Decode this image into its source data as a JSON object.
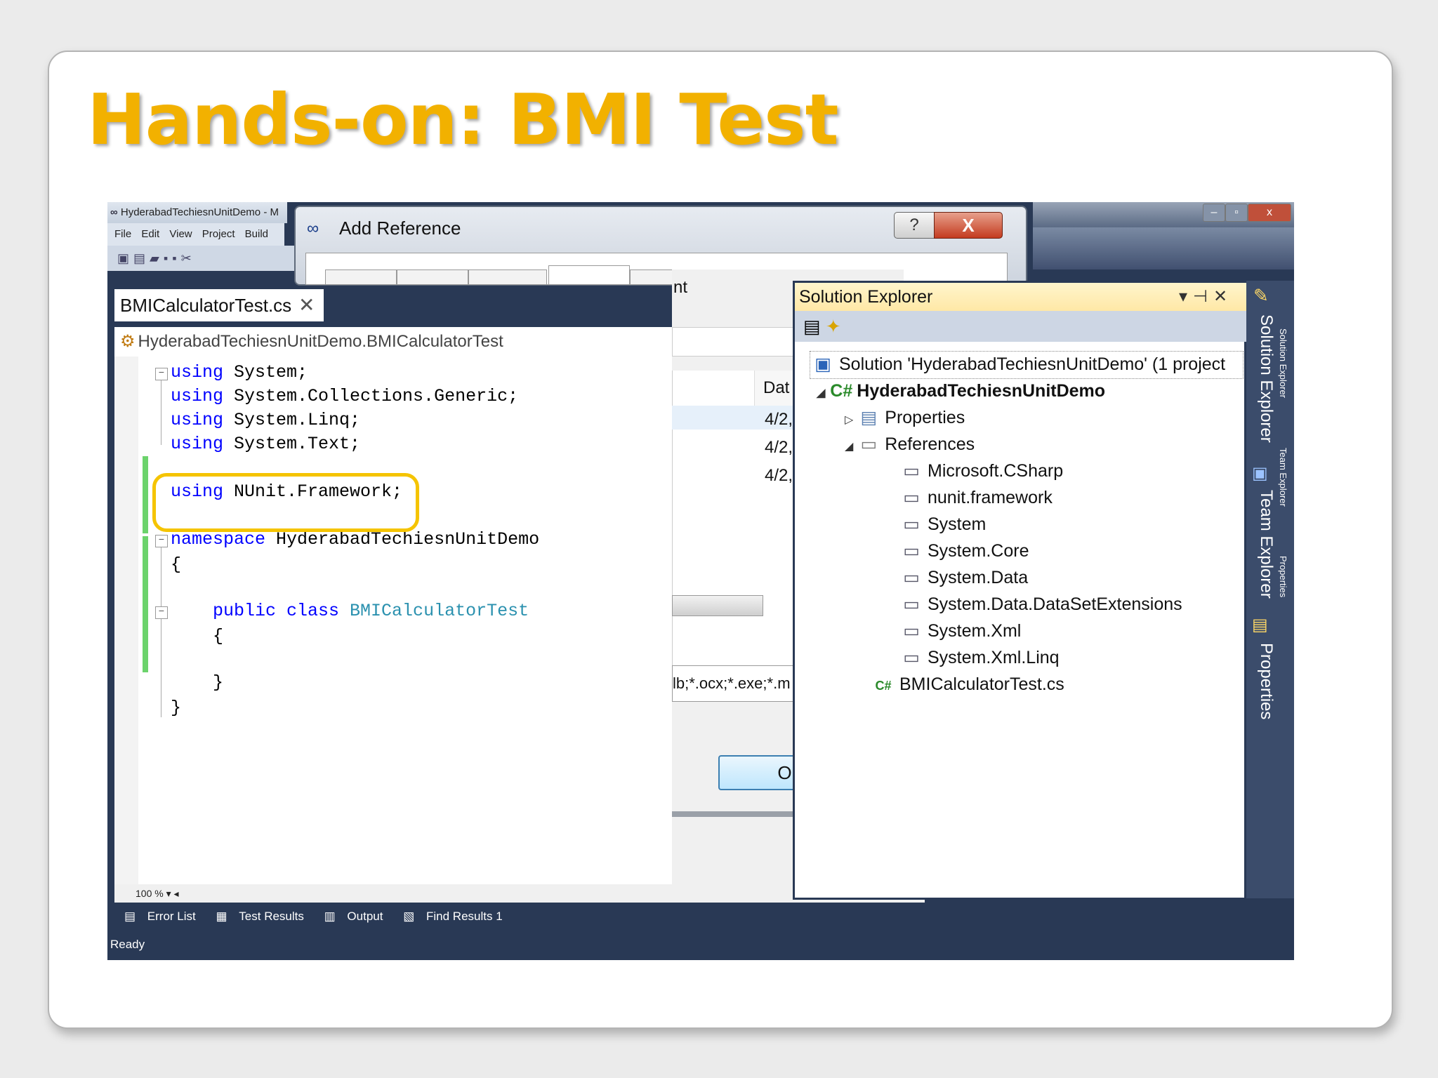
{
  "slide": {
    "title": "Hands-on: BMI Test"
  },
  "vs": {
    "title": "HyderabadTechiesnUnitDemo - M",
    "menu": [
      "File",
      "Edit",
      "View",
      "Project",
      "Build"
    ],
    "zoom": "100 %",
    "bottom_tabs": [
      "Error List",
      "Test Results",
      "Output",
      "Find Results 1"
    ],
    "status": "Ready"
  },
  "dialog": {
    "title": "Add Reference",
    "help": "?",
    "close": "X",
    "tab_fragment": "nt",
    "column_header": "Dat",
    "dates": [
      "4/2,",
      "4/2,",
      "4/2,"
    ],
    "filter": "lb;*.ocx;*.exe;*.m",
    "ok": "OK"
  },
  "editor": {
    "tab_label": "BMICalculatorTest.cs",
    "tab_close": "✕",
    "nav_path": "HyderabadTechiesnUnitDemo.BMICalculatorTest",
    "lines": {
      "l1_kw": "using",
      "l1_rest": " System;",
      "l2_kw": "using",
      "l2_rest": " System.Collections.Generic;",
      "l3_kw": "using",
      "l3_rest": " System.Linq;",
      "l4_kw": "using",
      "l4_rest": " System.Text;",
      "l5_kw": "using",
      "l5_rest": " NUnit.Framework;",
      "l6_kw": "namespace",
      "l6_rest": " HyderabadTechiesnUnitDemo",
      "l7": "{",
      "l8_kw": "public class",
      "l8_ty": "BMICalculatorTest",
      "l9": "{",
      "l10": "}",
      "l11": "}"
    }
  },
  "solution_explorer": {
    "title": "Solution Explorer",
    "solution": "Solution 'HyderabadTechiesnUnitDemo' (1 project",
    "project": "HyderabadTechiesnUnitDemo",
    "properties": "Properties",
    "references": "References",
    "refs": [
      "Microsoft.CSharp",
      "nunit.framework",
      "System",
      "System.Core",
      "System.Data",
      "System.Data.DataSetExtensions",
      "System.Xml",
      "System.Xml.Linq"
    ],
    "file": "BMICalculatorTest.cs"
  },
  "dock": {
    "tabs": [
      "Solution Explorer",
      "Team Explorer",
      "Properties"
    ]
  },
  "colors": {
    "title": "#f2b100",
    "keyword": "#0000ff",
    "type": "#2b91af",
    "highlight": "#f5c400",
    "vs_frame": "#293955"
  }
}
